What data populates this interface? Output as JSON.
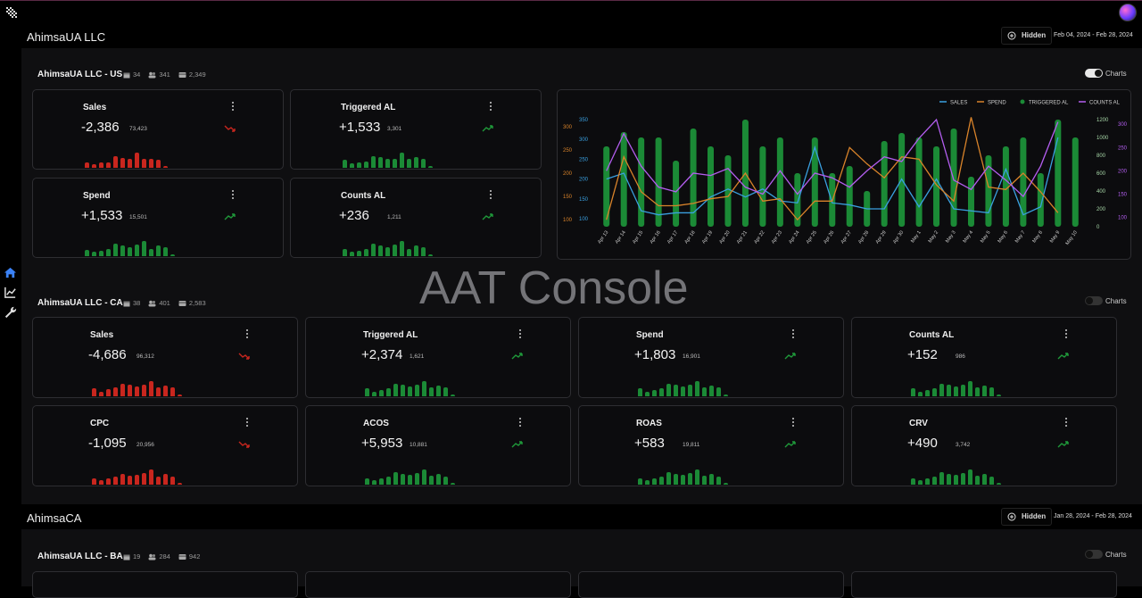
{
  "sections": [
    {
      "name": "AhimsaUA LLC",
      "hidden_label": "Hidden",
      "date_range": "Feb 04, 2024 - Feb 28, 2024"
    },
    {
      "name": "AhimsaCA",
      "hidden_label": "Hidden",
      "date_range": "Jan 28, 2024 - Feb 28, 2024"
    }
  ],
  "panels": [
    {
      "title": "AhimsaUA LLC - US",
      "meta": [
        "34",
        "341",
        "2,349"
      ],
      "charts_label": "Charts",
      "charts_on": true
    },
    {
      "title": "AhimsaUA LLC - CA",
      "meta": [
        "38",
        "401",
        "2,583"
      ],
      "charts_label": "Charts",
      "charts_on": false
    },
    {
      "title": "AhimsaUA LLC - BA",
      "meta": [
        "19",
        "284",
        "942"
      ],
      "charts_label": "Charts",
      "charts_on": false
    }
  ],
  "us_cards": [
    {
      "title": "Sales",
      "value": "-2,386",
      "sub": "73,423",
      "trend": "down",
      "bars": [
        0.35,
        0.2,
        0.35,
        0.35,
        0.7,
        0.6,
        0.55,
        0.95,
        0.55,
        0.55,
        0.5,
        0.1
      ]
    },
    {
      "title": "Triggered AL",
      "value": "+1,533",
      "sub": "3,301",
      "trend": "up",
      "bars": [
        0.5,
        0.25,
        0.35,
        0.4,
        0.7,
        0.65,
        0.55,
        0.55,
        0.95,
        0.55,
        0.65,
        0.55,
        0.1
      ]
    },
    {
      "title": "Spend",
      "value": "+1,533",
      "sub": "15,501",
      "trend": "up",
      "bars": [
        0.4,
        0.25,
        0.35,
        0.45,
        0.75,
        0.65,
        0.55,
        0.7,
        0.95,
        0.45,
        0.65,
        0.55,
        0.1
      ]
    },
    {
      "title": "Counts AL",
      "value": "+236",
      "sub": "1,211",
      "trend": "up",
      "bars": [
        0.45,
        0.25,
        0.35,
        0.45,
        0.75,
        0.65,
        0.55,
        0.7,
        0.95,
        0.45,
        0.65,
        0.55,
        0.1
      ]
    }
  ],
  "ca_cards": [
    {
      "title": "Sales",
      "value": "-4,686",
      "sub": "96,312",
      "trend": "down",
      "bars": [
        0.5,
        0.3,
        0.45,
        0.55,
        0.75,
        0.7,
        0.6,
        0.7,
        0.95,
        0.55,
        0.65,
        0.55,
        0.1
      ]
    },
    {
      "title": "Triggered AL",
      "value": "+2,374",
      "sub": "1,621",
      "trend": "up",
      "bars": [
        0.5,
        0.3,
        0.4,
        0.5,
        0.75,
        0.7,
        0.6,
        0.7,
        0.95,
        0.55,
        0.65,
        0.55,
        0.1
      ]
    },
    {
      "title": "Spend",
      "value": "+1,803",
      "sub": "16,901",
      "trend": "up",
      "bars": [
        0.5,
        0.3,
        0.4,
        0.5,
        0.75,
        0.7,
        0.6,
        0.7,
        0.95,
        0.55,
        0.65,
        0.55,
        0.1
      ]
    },
    {
      "title": "Counts AL",
      "value": "+152",
      "sub": "986",
      "trend": "up",
      "bars": [
        0.5,
        0.3,
        0.4,
        0.5,
        0.75,
        0.7,
        0.6,
        0.7,
        0.95,
        0.55,
        0.65,
        0.55,
        0.1
      ]
    },
    {
      "title": "CPC",
      "value": "-1,095",
      "sub": "20,956",
      "trend": "down",
      "bars": [
        0.4,
        0.25,
        0.4,
        0.5,
        0.65,
        0.55,
        0.6,
        0.7,
        0.95,
        0.5,
        0.65,
        0.5,
        0.1
      ]
    },
    {
      "title": "ACOS",
      "value": "+5,953",
      "sub": "10,881",
      "trend": "up",
      "bars": [
        0.4,
        0.25,
        0.4,
        0.5,
        0.75,
        0.65,
        0.6,
        0.7,
        0.95,
        0.55,
        0.65,
        0.5,
        0.1
      ]
    },
    {
      "title": "ROAS",
      "value": "+583",
      "sub": "19,811",
      "trend": "up",
      "bars": [
        0.4,
        0.25,
        0.4,
        0.5,
        0.75,
        0.65,
        0.6,
        0.7,
        0.95,
        0.55,
        0.65,
        0.5,
        0.1
      ]
    },
    {
      "title": "CRV",
      "value": "+490",
      "sub": "3,742",
      "trend": "up",
      "bars": [
        0.4,
        0.25,
        0.4,
        0.5,
        0.75,
        0.65,
        0.6,
        0.7,
        0.95,
        0.55,
        0.65,
        0.5,
        0.1
      ]
    }
  ],
  "colors": {
    "up": "#1f9a3a",
    "down": "#c8261e",
    "bar_green": "#1b8a36",
    "sales": "#3aa0e0",
    "spend": "#d9832a",
    "triggered": "#1b8a36",
    "counts": "#b45ef0"
  },
  "watermark": "AAT Console",
  "chart_data": {
    "type": "line",
    "legend": [
      "SALES",
      "SPEND",
      "TRIGGERED AL",
      "COUNTS AL"
    ],
    "legend_position": "top-right",
    "categories": [
      "Apr 13",
      "Apr 14",
      "Apr 15",
      "Apr 16",
      "Apr 17",
      "Apr 18",
      "Apr 19",
      "Apr 20",
      "Apr 21",
      "Apr 22",
      "Apr 23",
      "Apr 24",
      "Apr 25",
      "Apr 26",
      "Apr 27",
      "Apr 28",
      "Apr 29",
      "Apr 30",
      "May 1",
      "May 2",
      "May 3",
      "May 4",
      "May 5",
      "May 6",
      "May 7",
      "May 8",
      "May 9",
      "May 10"
    ],
    "y_ticks_sales": [
      "100",
      "150",
      "200",
      "250",
      "300",
      "350"
    ],
    "y_ticks_spend": [
      "100",
      "150",
      "200",
      "250",
      "300"
    ],
    "y_ticks_triggered": [
      "0",
      "200",
      "400",
      "600",
      "800",
      "1000",
      "1200"
    ],
    "y_ticks_counts": [
      "100",
      "150",
      "200",
      "250",
      "300"
    ],
    "series": [
      {
        "name": "TRIGGERED AL",
        "type": "bar",
        "values": [
          900,
          1060,
          1000,
          1000,
          740,
          1100,
          900,
          800,
          1200,
          900,
          1000,
          600,
          1000,
          600,
          680,
          400,
          960,
          1050,
          1000,
          900,
          1100,
          560,
          800,
          900,
          1000,
          600,
          1200,
          1000
        ]
      },
      {
        "name": "SALES",
        "type": "line",
        "values": [
          200,
          215,
          120,
          110,
          115,
          115,
          155,
          175,
          155,
          175,
          145,
          140,
          280,
          140,
          135,
          125,
          125,
          200,
          130,
          200,
          125,
          120,
          115,
          225,
          110,
          130,
          305
        ]
      },
      {
        "name": "SPEND",
        "type": "line",
        "values": [
          100,
          235,
          160,
          130,
          130,
          135,
          145,
          150,
          200,
          140,
          145,
          100,
          140,
          140,
          255,
          220,
          190,
          235,
          230,
          175,
          140,
          320,
          170,
          165,
          200,
          160,
          115
        ]
      },
      {
        "name": "COUNTS AL",
        "type": "line",
        "values": [
          200,
          280,
          210,
          165,
          155,
          195,
          190,
          205,
          165,
          150,
          200,
          150,
          195,
          185,
          165,
          200,
          230,
          220,
          270,
          310,
          180,
          160,
          210,
          180,
          145,
          210,
          305
        ]
      }
    ]
  }
}
